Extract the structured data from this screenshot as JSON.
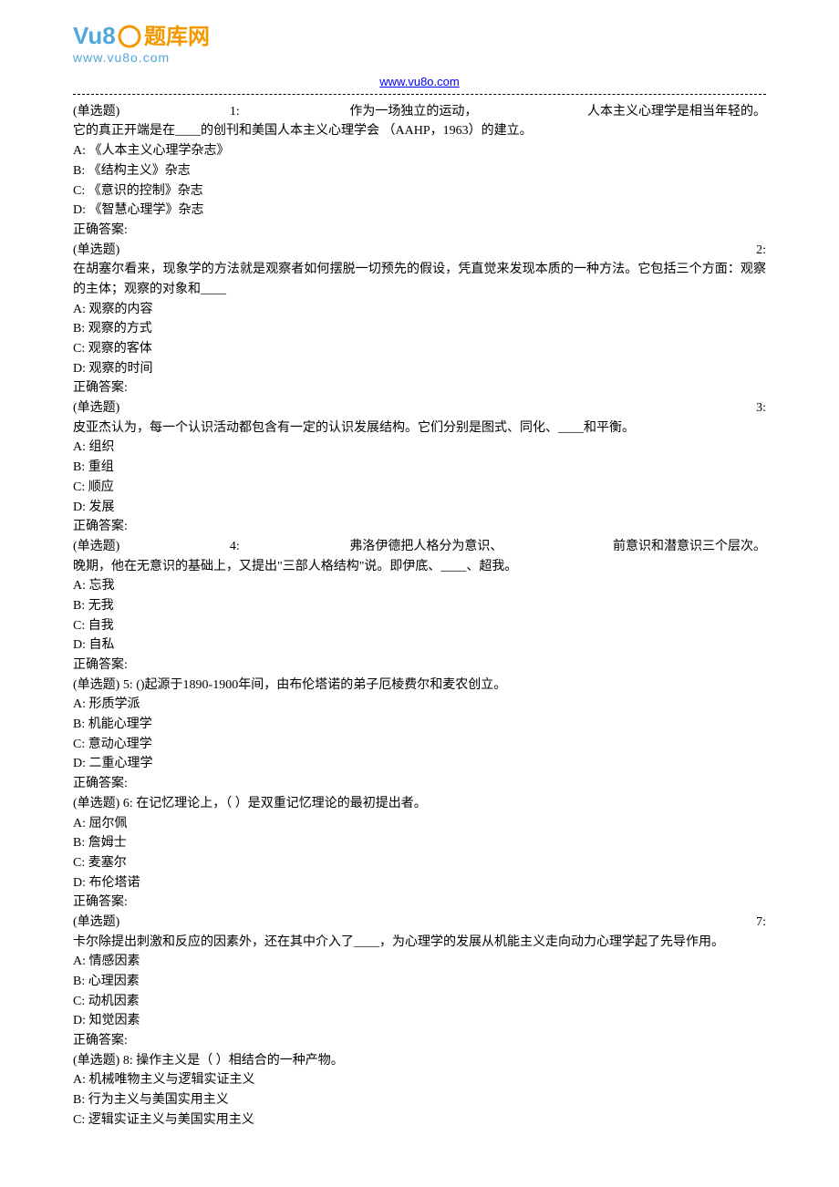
{
  "logo": {
    "brand_text": "题库网",
    "url": "www.vu8o.com"
  },
  "header_link": "www.vu8o.com",
  "questions": [
    {
      "type": "(单选题)",
      "number": "1:",
      "intro_right": "人本主义心理学是相当年轻的。",
      "intro_mid": "作为一场独立的运动，",
      "text": "它的真正开端是在____的创刊和美国人本主义心理学会 （AAHP，1963）的建立。",
      "options": [
        "A: 《人本主义心理学杂志》",
        "B: 《结构主义》杂志",
        "C: 《意识的控制》杂志",
        "D: 《智慧心理学》杂志"
      ],
      "answer": "正确答案:"
    },
    {
      "type": "(单选题)",
      "number": "2:",
      "text": "在胡塞尔看来，现象学的方法就是观察者如何摆脱一切预先的假设，凭直觉来发现本质的一种方法。它包括三个方面：观察的主体；观察的对象和____",
      "options": [
        "A: 观察的内容",
        "B: 观察的方式",
        "C: 观察的客体",
        "D: 观察的时间"
      ],
      "answer": "正确答案:"
    },
    {
      "type": "(单选题)",
      "number": "3:",
      "text": "皮亚杰认为，每一个认识活动都包含有一定的认识发展结构。它们分别是图式、同化、____和平衡。",
      "options": [
        "A: 组织",
        "B: 重组",
        "C: 顺应",
        "D: 发展"
      ],
      "answer": "正确答案:"
    },
    {
      "type": "(单选题)",
      "number": "4:",
      "intro_mid": "弗洛伊德把人格分为意识、",
      "intro_right": "前意识和潜意识三个层次。",
      "text": "晚期，他在无意识的基础上，又提出\"三部人格结构\"说。即伊底、____、超我。",
      "options": [
        "A: 忘我",
        "B: 无我",
        "C: 自我",
        "D: 自私"
      ],
      "answer": "正确答案:"
    },
    {
      "type": "(单选题)",
      "number": "5:",
      "text": "()起源于1890-1900年间，由布伦塔诺的弟子厄棱费尔和麦农创立。",
      "options": [
        "A: 形质学派",
        "B: 机能心理学",
        "C: 意动心理学",
        "D: 二重心理学"
      ],
      "answer": "正确答案:",
      "inline": true
    },
    {
      "type": "(单选题)",
      "number": "6:",
      "text": "在记忆理论上，（ ）是双重记忆理论的最初提出者。",
      "options": [
        "A: 屈尔佩",
        "B: 詹姆士",
        "C: 麦塞尔",
        "D: 布伦塔诺"
      ],
      "answer": "正确答案:",
      "inline": true
    },
    {
      "type": "(单选题)",
      "number": "7:",
      "text": "卡尔除提出刺激和反应的因素外，还在其中介入了____，为心理学的发展从机能主义走向动力心理学起了先导作用。",
      "options": [
        "A: 情感因素",
        "B: 心理因素",
        "C: 动机因素",
        "D: 知觉因素"
      ],
      "answer": "正确答案:"
    },
    {
      "type": "(单选题)",
      "number": "8:",
      "text": "操作主义是（ ）相结合的一种产物。",
      "options": [
        "A: 机械唯物主义与逻辑实证主义",
        "B: 行为主义与美国实用主义",
        "C: 逻辑实证主义与美国实用主义"
      ],
      "answer": "正确答案:",
      "inline": true
    }
  ]
}
